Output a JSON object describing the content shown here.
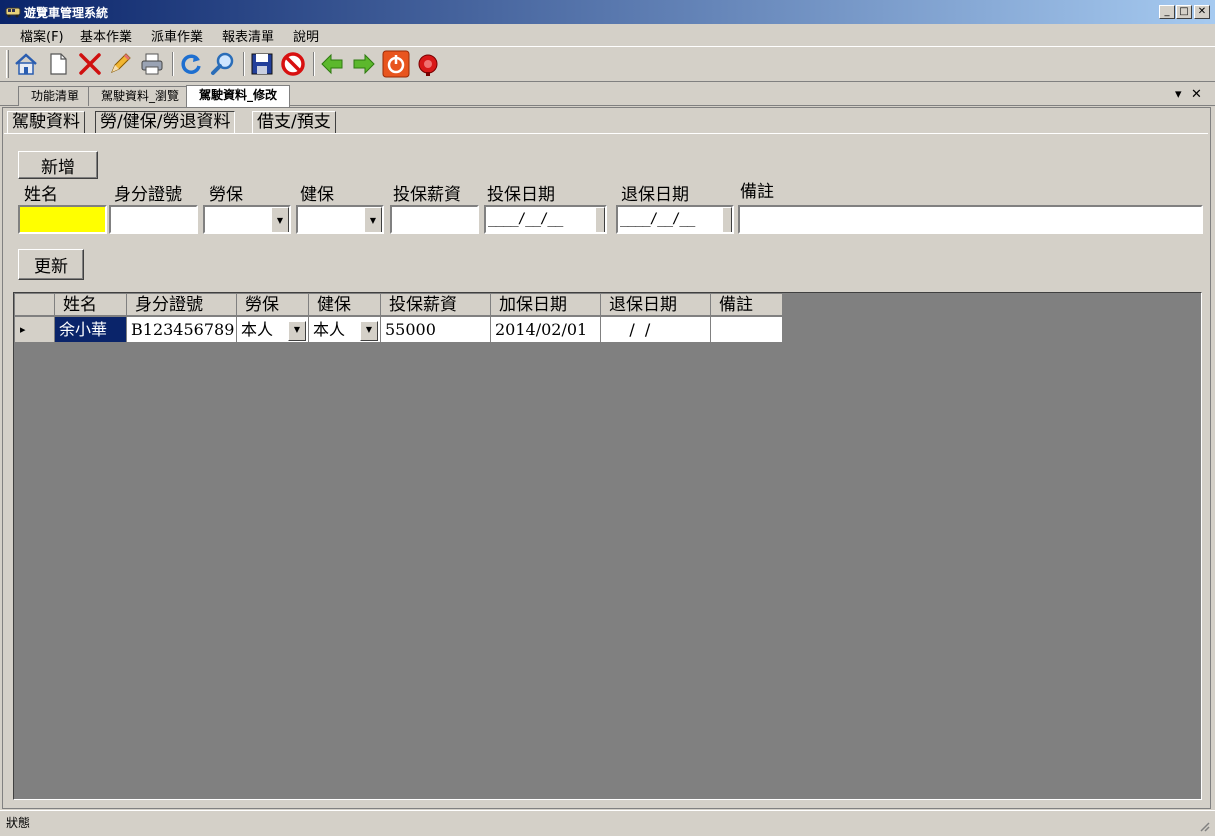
{
  "window": {
    "title": "遊覽車管理系統",
    "minimize": "_",
    "maximize": "□",
    "close": "✕"
  },
  "menu": [
    "檔案(F)",
    "基本作業",
    "派車作業",
    "報表清單",
    "說明"
  ],
  "toolbar": {
    "icons": [
      "home-icon",
      "new-document-icon",
      "delete-icon",
      "edit-icon",
      "print-icon",
      "refresh-icon",
      "search-icon",
      "save-icon",
      "cancel-icon",
      "back-icon",
      "forward-icon",
      "power-icon",
      "alarm-icon"
    ]
  },
  "doc_tabs": [
    "功能清單",
    "駕駛資料_瀏覽",
    "駕駛資料_修改"
  ],
  "doc_tab_controls": {
    "dropdown": "▾",
    "close": "✕"
  },
  "page_tabs": [
    "駕駛資料",
    "勞/健保/勞退資料",
    "借支/預支"
  ],
  "form": {
    "add_button": "新增",
    "update_button": "更新",
    "labels": {
      "name": "姓名",
      "id_no": "身分證號",
      "labor_ins": "勞保",
      "health_ins": "健保",
      "salary": "投保薪資",
      "start_date": "投保日期",
      "end_date": "退保日期",
      "note": "備註"
    },
    "values": {
      "name": "",
      "id_no": "",
      "labor_ins": "",
      "health_ins": "",
      "salary": "",
      "start_date": "____/__/__",
      "end_date": "____/__/__",
      "note": ""
    }
  },
  "grid": {
    "columns": [
      "姓名",
      "身分證號",
      "勞保",
      "健保",
      "投保薪資",
      "加保日期",
      "退保日期",
      "備註"
    ],
    "rows": [
      {
        "indicator": "▸",
        "name": "余小華",
        "id_no": "B123456789",
        "labor_ins": "本人",
        "health_ins": "本人",
        "salary": "55000",
        "start_date": "2014/02/01",
        "end_date": "    /  /",
        "note": ""
      }
    ]
  },
  "status": "狀態",
  "colors": {
    "title_bar_start": "#0a246a",
    "title_bar_end": "#a6caf0",
    "face": "#d4d0c8",
    "grid_bg": "#808080",
    "highlight_field": "#ffff00",
    "selected_cell": "#0a246a"
  }
}
